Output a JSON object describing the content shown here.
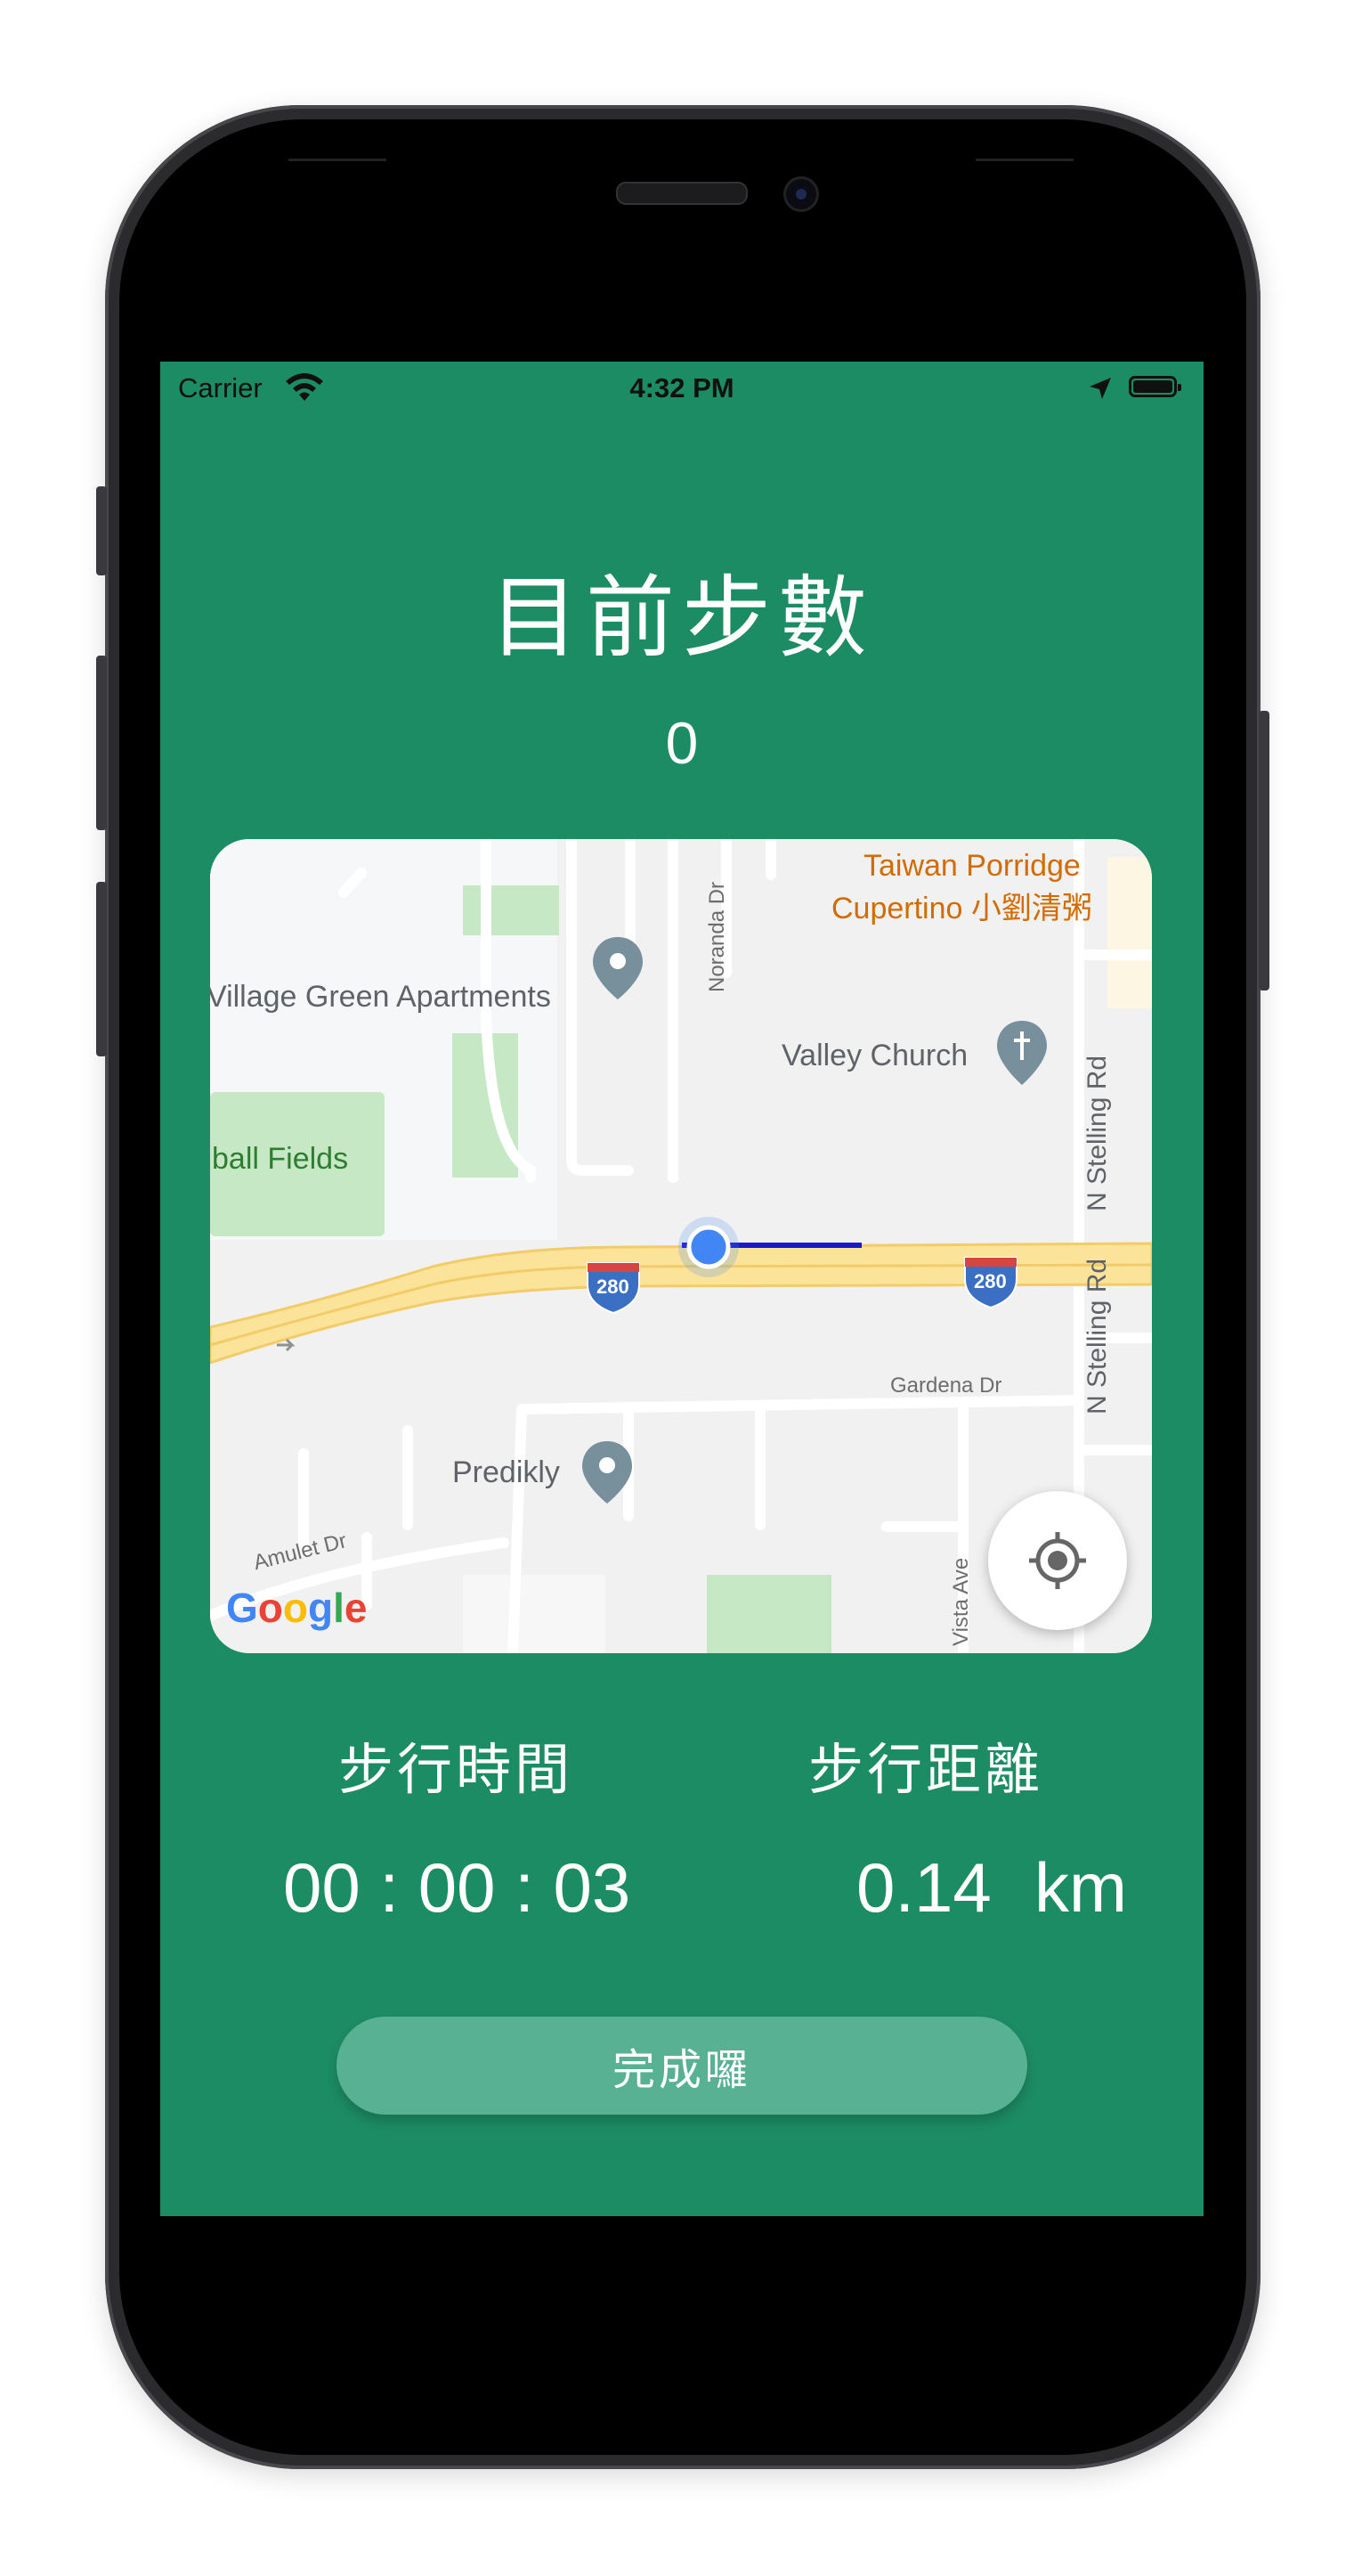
{
  "status_bar": {
    "carrier": "Carrier",
    "time": "4:32 PM"
  },
  "page": {
    "title": "目前步數",
    "step_count": "0"
  },
  "map": {
    "labels": {
      "village_green": "Village Green Apartments",
      "ball_fields": "ball Fields",
      "valley_church": "Valley Church",
      "taiwan_porridge_line1": "Taiwan Porridge",
      "taiwan_porridge_line2": "Cupertino 小劉清粥",
      "noranda": "Noranda Dr",
      "n_stelling_1": "N Stelling Rd",
      "n_stelling_2": "N Stelling Rd",
      "gardena": "Gardena Dr",
      "predikly": "Predikly",
      "amulet": "Amulet Dr",
      "vista": "Vista Ave",
      "highway_shield": "280"
    },
    "attribution": "Google"
  },
  "stats": {
    "time_label": "步行時間",
    "time_value": "00 : 00 : 03",
    "distance_label": "步行距離",
    "distance_value": "0.14",
    "distance_unit": "km"
  },
  "actions": {
    "done_label": "完成囉"
  },
  "colors": {
    "background": "#1c8c64",
    "button": "#57b192",
    "route": "#1a1acc",
    "user_location": "#4285f4"
  }
}
